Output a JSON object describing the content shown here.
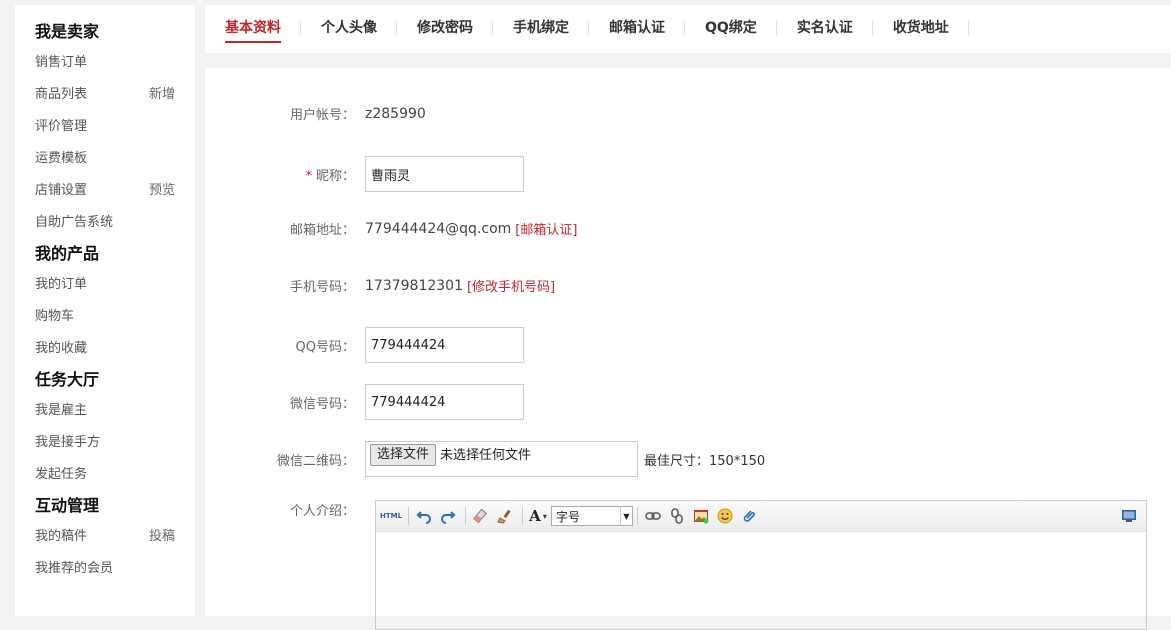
{
  "sidebar": {
    "groups": [
      {
        "title": "我是卖家",
        "items": [
          {
            "label": "销售订单",
            "extra": ""
          },
          {
            "label": "商品列表",
            "extra": "新增"
          },
          {
            "label": "评价管理",
            "extra": ""
          },
          {
            "label": "运费模板",
            "extra": ""
          },
          {
            "label": "店铺设置",
            "extra": "预览"
          },
          {
            "label": "自助广告系统",
            "extra": ""
          }
        ]
      },
      {
        "title": "我的产品",
        "items": [
          {
            "label": "我的订单",
            "extra": ""
          },
          {
            "label": "购物车",
            "extra": ""
          },
          {
            "label": "我的收藏",
            "extra": ""
          }
        ]
      },
      {
        "title": "任务大厅",
        "items": [
          {
            "label": "我是雇主",
            "extra": ""
          },
          {
            "label": "我是接手方",
            "extra": ""
          },
          {
            "label": "发起任务",
            "extra": ""
          }
        ]
      },
      {
        "title": "互动管理",
        "items": [
          {
            "label": "我的稿件",
            "extra": "投稿"
          },
          {
            "label": "我推荐的会员",
            "extra": ""
          }
        ]
      }
    ]
  },
  "tabs": [
    "基本资料",
    "个人头像",
    "修改密码",
    "手机绑定",
    "邮箱认证",
    "QQ绑定",
    "实名认证",
    "收货地址"
  ],
  "form": {
    "account_label": "用户帐号：",
    "account_value": "z285990",
    "nickname_required": "*",
    "nickname_label": "昵称：",
    "nickname_value": "曹雨灵",
    "email_label": "邮箱地址：",
    "email_value": "779444424@qq.com",
    "email_link": "[邮箱认证]",
    "phone_label": "手机号码：",
    "phone_value": "17379812301",
    "phone_link": "[修改手机号码]",
    "qq_label": "QQ号码：",
    "qq_value": "779444424",
    "wechat_label": "微信号码：",
    "wechat_value": "779444424",
    "qrcode_label": "微信二维码：",
    "file_button": "选择文件",
    "file_status": "未选择任何文件",
    "size_hint": "最佳尺寸：150*150",
    "intro_label": "个人介绍："
  },
  "editor": {
    "html_label": "HTML",
    "font_glyph": "A",
    "font_size_label": "字号"
  },
  "colors": {
    "accent": "#c1272d"
  }
}
